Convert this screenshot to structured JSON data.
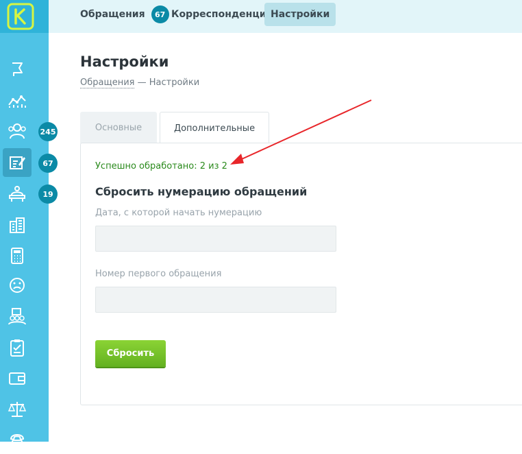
{
  "topnav": {
    "items": [
      {
        "label": "Обращения",
        "badge": "67"
      },
      {
        "label": "Корреспонденция"
      },
      {
        "label": "Настройки",
        "active": true
      }
    ]
  },
  "sidebar": {
    "badges": {
      "clients": "245",
      "requests": "67",
      "reception": "19"
    },
    "icons": [
      "flag-icon",
      "analytics-icon",
      "clients-icon",
      "requests-icon",
      "reception-icon",
      "buildings-icon",
      "calculator-icon",
      "sad-face-icon",
      "staff-icon",
      "checklist-icon",
      "wallet-icon",
      "scales-icon",
      "phone-icon"
    ]
  },
  "page": {
    "title": "Настройки",
    "breadcrumb": {
      "link": "Обращения",
      "separator": "—",
      "current": "Настройки"
    }
  },
  "tabs": [
    {
      "label": "Основные",
      "active": false
    },
    {
      "label": "Дополнительные",
      "active": true
    }
  ],
  "form": {
    "success_message": "Успешно обработано: 2 из 2",
    "section_title": "Сбросить нумерацию обращений",
    "date_label": "Дата, с которой начать нумерацию",
    "date_value": "",
    "number_label": "Номер первого обращения",
    "number_value": "",
    "submit_label": "Сбросить"
  },
  "colors": {
    "sidebar": "#4fc3e6",
    "badge": "#0b8aa6",
    "success": "#2a8a1c",
    "button": "#74c22a",
    "arrow": "#e8262a"
  }
}
